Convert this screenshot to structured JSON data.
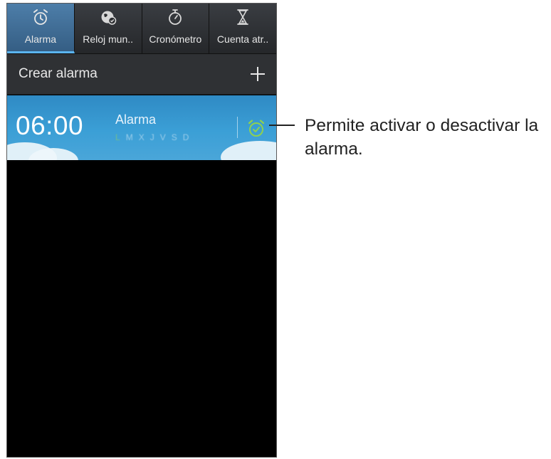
{
  "tabs": [
    {
      "label": "Alarma",
      "icon": "alarm-clock-icon",
      "active": true
    },
    {
      "label": "Reloj mun..",
      "icon": "world-clock-icon",
      "active": false
    },
    {
      "label": "Cronómetro",
      "icon": "stopwatch-icon",
      "active": false
    },
    {
      "label": "Cuenta atr..",
      "icon": "hourglass-icon",
      "active": false
    }
  ],
  "create": {
    "label": "Crear alarma",
    "icon": "plus-icon"
  },
  "alarm": {
    "time": "06:00",
    "name": "Alarma",
    "days": [
      "L",
      "M",
      "X",
      "J",
      "V",
      "S",
      "D"
    ],
    "toggle_icon": "alarm-clock-icon",
    "toggle_color": "#8fd14f"
  },
  "callout": {
    "line1": "Permite activar o desactivar la",
    "line2": "alarma."
  },
  "colors": {
    "tab_active": "#4d7ea9",
    "tab_indicator": "#5bb4ef",
    "alarm_row": "#3b9fd6",
    "background": "#000000"
  }
}
